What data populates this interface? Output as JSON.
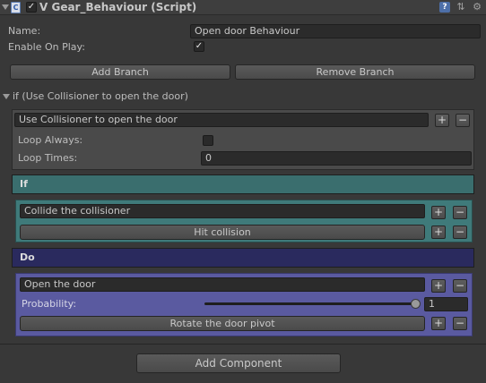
{
  "component": {
    "enabled": true,
    "title": "V Gear_Behaviour (Script)",
    "icons": [
      "script-icon",
      "help-icon",
      "preset-icon",
      "settings-icon"
    ]
  },
  "fields": {
    "name_label": "Name:",
    "name_value": "Open door Behaviour",
    "enable_label": "Enable On Play:",
    "enable_checked": true
  },
  "branch_buttons": {
    "add": "Add Branch",
    "remove": "Remove Branch"
  },
  "branch": {
    "foldout_label": "if (Use Collisioner to open the door)",
    "name_value": "Use Collisioner to open the door",
    "loop_always_label": "Loop Always:",
    "loop_always_checked": false,
    "loop_times_label": "Loop Times:",
    "loop_times_value": "0",
    "plus": "+",
    "minus": "−"
  },
  "if_section": {
    "header": "If",
    "condition_value": "Collide the collisioner",
    "sub_button": "Hit collision"
  },
  "do_section": {
    "header": "Do",
    "action_value": "Open the door",
    "probability_label": "Probability:",
    "probability_value": "1",
    "slider_fraction": 1.0,
    "sub_button": "Rotate the door pivot"
  },
  "footer": {
    "add_component": "Add Component"
  },
  "colors": {
    "background": "#383838",
    "if_header": "#3a6e6e",
    "if_panel": "#3f7a7a",
    "do_header": "#2a2a5e",
    "do_panel": "#5a5aa0"
  }
}
